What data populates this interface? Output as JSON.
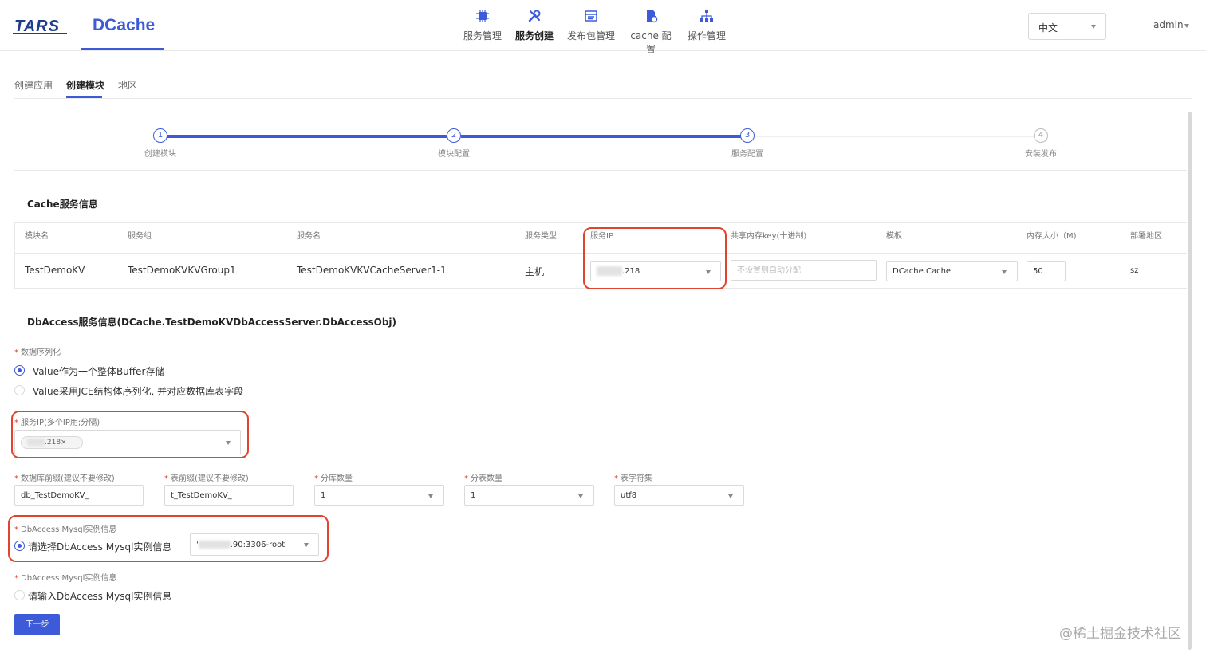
{
  "header": {
    "logo_left": "TARS",
    "logo_right": "DCache",
    "nav": [
      {
        "label": "服务管理",
        "icon": "chip-icon"
      },
      {
        "label": "服务创建",
        "icon": "wrench-icon"
      },
      {
        "label": "发布包管理",
        "icon": "package-icon"
      },
      {
        "label": "cache 配置",
        "icon": "file-settings-icon"
      },
      {
        "label": "操作管理",
        "icon": "hierarchy-icon"
      }
    ],
    "language": "中文",
    "user": "admin"
  },
  "tabs": [
    "创建应用",
    "创建模块",
    "地区"
  ],
  "steps": [
    {
      "num": "1",
      "label": "创建模块"
    },
    {
      "num": "2",
      "label": "模块配置"
    },
    {
      "num": "3",
      "label": "服务配置"
    },
    {
      "num": "4",
      "label": "安装发布"
    }
  ],
  "cache": {
    "title": "Cache服务信息",
    "headers": [
      "模块名",
      "服务组",
      "服务名",
      "服务类型",
      "服务IP",
      "共享内存key(十进制)",
      "模板",
      "内存大小（M)",
      "部署地区"
    ],
    "row": {
      "module": "TestDemoKV",
      "group": "TestDemoKVKVGroup1",
      "server": "TestDemoKVKVCacheServer1-1",
      "type": "主机",
      "ip": ".218",
      "shm_placeholder": "不设置则自动分配",
      "template": "DCache.Cache",
      "mem": "50",
      "region": "sz"
    }
  },
  "db": {
    "title": "DbAccess服务信息(DCache.TestDemoKVDbAccessServer.DbAccessObj)",
    "serialize_label": "数据序列化",
    "serialize_opt1": "Value作为一个整体Buffer存储",
    "serialize_opt2": "Value采用JCE结构体序列化, 并对应数据库表字段",
    "ip_label": "服务IP(多个IP用;分隔)",
    "ip_tag": ".218",
    "ip_tag_close": "×",
    "db_prefix_label": "数据库前缀(建议不要修改)",
    "db_prefix": "db_TestDemoKV_",
    "table_prefix_label": "表前缀(建议不要修改)",
    "table_prefix": "t_TestDemoKV_",
    "db_count_label": "分库数量",
    "db_count": "1",
    "table_count_label": "分表数量",
    "table_count": "1",
    "charset_label": "表字符集",
    "charset": "utf8",
    "mysql_label1": "DbAccess Mysql实例信息",
    "mysql_select_text": "请选择DbAccess Mysql实例信息",
    "mysql_value_prefix": "'",
    "mysql_value": ".90:3306-root",
    "mysql_label2": "DbAccess Mysql实例信息",
    "mysql_input_text": "请输入DbAccess Mysql实例信息"
  },
  "next_button": "下一步",
  "watermark": "@稀土掘金技术社区",
  "colors": {
    "accent": "#3d5bd9",
    "highlight": "#e0432e"
  }
}
